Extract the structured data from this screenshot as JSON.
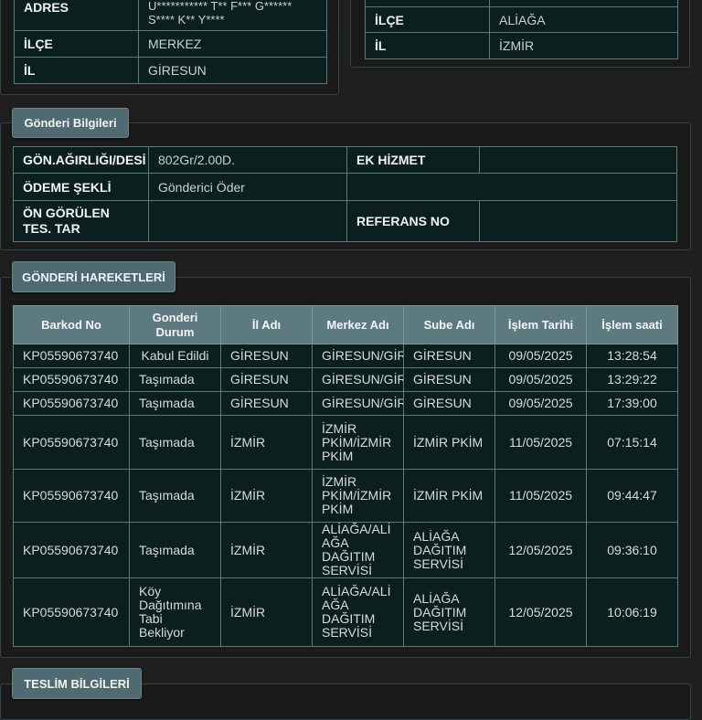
{
  "sender": {
    "rows": [
      {
        "label": "ADRES",
        "value": "U*********** T** F*** G****** S**** K** Y****"
      },
      {
        "label": "İLÇE",
        "value": "MERKEZ"
      },
      {
        "label": "İL",
        "value": "GİRESUN"
      }
    ]
  },
  "receiver": {
    "rows": [
      {
        "label": "İLÇE",
        "value": "ALİAĞA"
      },
      {
        "label": "İL",
        "value": "İZMİR"
      }
    ]
  },
  "shipment_info": {
    "tab_label": "Gönderi Bilgileri",
    "weight_label": "GÖN.AĞIRLIĞI/DESİ",
    "weight_value": "802Gr/2.00D.",
    "extra_service_label": "EK HİZMET",
    "extra_service_value": "",
    "payment_label": "ÖDEME ŞEKLİ",
    "payment_value": "Gönderici Öder",
    "eta_label": "ÖN GÖRÜLEN TES. TAR",
    "eta_value": "",
    "reference_label": "REFERANS NO",
    "reference_value": ""
  },
  "movements": {
    "tab_label": "GÖNDERİ HAREKETLERİ",
    "headers": [
      "Barkod No",
      "Gonderi Durum",
      "İl Adı",
      "Merkez Adı",
      "Sube Adı",
      "İşlem Tarihi",
      "İşlem saati"
    ],
    "rows": [
      [
        "KP05590673740",
        "Kabul Edildi",
        "GİRESUN",
        "GİRESUN/GİRESUN",
        "GİRESUN",
        "09/05/2025",
        "13:28:54"
      ],
      [
        "KP05590673740",
        "Taşımada",
        "GİRESUN",
        "GİRESUN/GİRESUN",
        "GİRESUN",
        "09/05/2025",
        "13:29:22"
      ],
      [
        "KP05590673740",
        "Taşımada",
        "GİRESUN",
        "GİRESUN/GİRESUN",
        "GİRESUN",
        "09/05/2025",
        "17:39:00"
      ],
      [
        "KP05590673740",
        "Taşımada",
        "İZMİR",
        "İZMİR PKİM/İZMİR PKİM",
        "İZMİR PKİM",
        "11/05/2025",
        "07:15:14"
      ],
      [
        "KP05590673740",
        "Taşımada",
        "İZMİR",
        "İZMİR PKİM/İZMİR PKİM",
        "İZMİR PKİM",
        "11/05/2025",
        "09:44:47"
      ],
      [
        "KP05590673740",
        "Taşımada",
        "İZMİR",
        "ALİAĞA/ALİAĞA DAĞITIM SERVİSİ",
        "ALİAĞA DAĞITIM SERVİSİ",
        "12/05/2025",
        "09:36:10"
      ],
      [
        "KP05590673740",
        "Köy Dağıtımına Tabi Bekliyor",
        "İZMİR",
        "ALİAĞA/ALİAĞA DAĞITIM SERVİSİ",
        "ALİAĞA DAĞITIM SERVİSİ",
        "12/05/2025",
        "10:06:19"
      ]
    ]
  },
  "delivery_info": {
    "tab_label": "TESLİM BİLGİLERİ"
  }
}
